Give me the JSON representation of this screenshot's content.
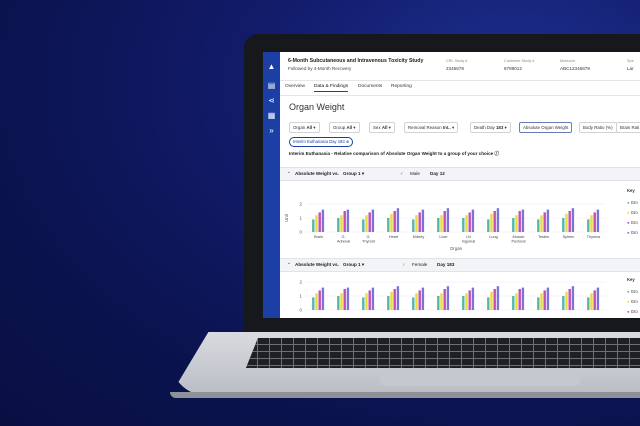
{
  "study": {
    "title": "6-Month Subcutaneous and Intravenous Toxicity Study",
    "subtitle": "Followed by 4-Month Recovery",
    "meta": [
      {
        "label": "CRL Study #",
        "value": "2345678"
      },
      {
        "label": "Customer Study #",
        "value": "6789012"
      },
      {
        "label": "Molecule",
        "value": "ABC12345678"
      },
      {
        "label": "Spe",
        "value": "Lar"
      }
    ]
  },
  "tabs": [
    "Overview",
    "Data & Findings",
    "Documents",
    "Reporting"
  ],
  "page_title": "Organ Weight",
  "filters": [
    {
      "label": "Organ",
      "value": "All"
    },
    {
      "label": "Group",
      "value": "All"
    },
    {
      "label": "Sex",
      "value": "All"
    },
    {
      "label": "Removal Reason",
      "value": "Int.."
    },
    {
      "label": "Death Day",
      "value": "183"
    },
    {
      "label": "Absolute Organ Weight",
      "value": ""
    },
    {
      "label": "Body Ratio (%)",
      "value": ""
    },
    {
      "label": "Brain Rati",
      "value": ""
    }
  ],
  "chip": "Interim Euthanasia Day 183",
  "subtitle": "Interim Euthanasia - Relative comparison of Absolute Organ Weight to a group of your choice",
  "panels": [
    {
      "compare_label": "Absolute Weight vs.",
      "group": "Group 1",
      "sex": "Male",
      "day": "Day 12"
    },
    {
      "compare_label": "Absolute Weight vs.",
      "group": "Group 1",
      "sex": "Female",
      "day": "Day 183"
    }
  ],
  "key_title": "Key",
  "key_items": [
    "Gro",
    "Gro",
    "Gro",
    "Gro"
  ],
  "colors": {
    "sidebar": "#1c3fa6",
    "series": [
      "#56b7a9",
      "#e9dc3d",
      "#c14fb6",
      "#7b74d6"
    ]
  },
  "chart_data": {
    "type": "bar",
    "categories": [
      "Brain",
      "G. Adrenal",
      "G. Thyroid",
      "Heart",
      "Kidney",
      "Liver",
      "LN Inguinal",
      "Lung",
      "Muscle Pectoral",
      "Testes",
      "Spleen",
      "Thymus"
    ],
    "ylabel": "Unit",
    "xlabel": "Organ",
    "ylim": [
      0,
      2
    ],
    "yticks": [
      "2",
      "1",
      "0"
    ],
    "series": [
      {
        "values": [
          0.9,
          1.0,
          0.9,
          1.0,
          0.9,
          1.0,
          1.0,
          0.9,
          1.0,
          0.9,
          1.0,
          0.9
        ]
      },
      {
        "values": [
          1.2,
          1.2,
          1.2,
          1.3,
          1.2,
          1.2,
          1.2,
          1.3,
          1.2,
          1.2,
          1.3,
          1.2
        ]
      },
      {
        "values": [
          1.4,
          1.5,
          1.4,
          1.5,
          1.4,
          1.5,
          1.4,
          1.5,
          1.5,
          1.4,
          1.5,
          1.4
        ]
      },
      {
        "values": [
          1.6,
          1.6,
          1.6,
          1.7,
          1.6,
          1.7,
          1.6,
          1.7,
          1.6,
          1.6,
          1.7,
          1.6
        ]
      }
    ]
  }
}
